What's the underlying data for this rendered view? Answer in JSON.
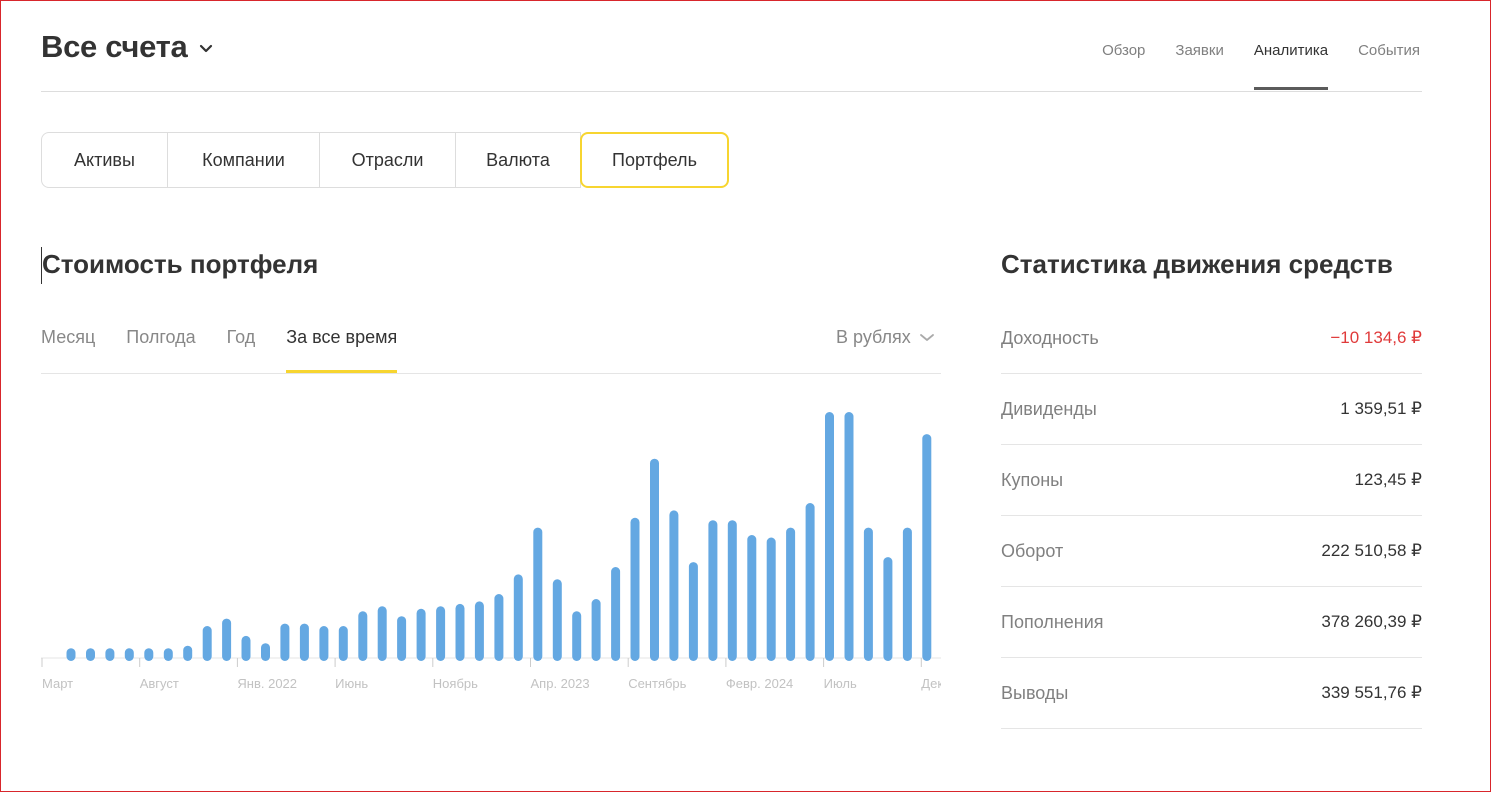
{
  "header": {
    "account_title": "Все счета",
    "tabs": [
      {
        "label": "Обзор"
      },
      {
        "label": "Заявки"
      },
      {
        "label": "Аналитика",
        "active": true
      },
      {
        "label": "События"
      }
    ]
  },
  "segments": [
    {
      "label": "Активы"
    },
    {
      "label": "Компании"
    },
    {
      "label": "Отрасли"
    },
    {
      "label": "Валюта"
    },
    {
      "label": "Портфель",
      "active": true
    }
  ],
  "portfolio": {
    "title": "Стоимость портфеля",
    "periods": [
      {
        "label": "Месяц"
      },
      {
        "label": "Полгода"
      },
      {
        "label": "Год"
      },
      {
        "label": "За все время",
        "active": true
      }
    ],
    "currency_select": "В рублях"
  },
  "chart_data": {
    "type": "bar",
    "color": "#64a8e2",
    "x_tick_labels": [
      "Март",
      "Август",
      "Янв. 2022",
      "Июнь",
      "Ноябрь",
      "Апр. 2023",
      "Сентябрь",
      "Февр. 2024",
      "Июль",
      "Дек"
    ],
    "values": [
      4,
      4,
      4,
      4,
      4,
      4,
      5,
      13,
      16,
      9,
      6,
      14,
      14,
      13,
      13,
      19,
      21,
      17,
      20,
      21,
      22,
      23,
      26,
      34,
      53,
      32,
      19,
      24,
      37,
      57,
      81,
      60,
      39,
      56,
      56,
      50,
      49,
      53,
      63,
      100,
      100,
      53,
      41,
      53,
      91
    ],
    "ylim": [
      0,
      100
    ],
    "grid": false,
    "legend": "none"
  },
  "stats": {
    "title": "Статистика движения средств",
    "rows": [
      {
        "label": "Доходность",
        "value": "−10 134,6 ₽",
        "negative": true
      },
      {
        "label": "Дивиденды",
        "value": "1 359,51 ₽"
      },
      {
        "label": "Купоны",
        "value": "123,45 ₽"
      },
      {
        "label": "Оборот",
        "value": "222 510,58 ₽"
      },
      {
        "label": "Пополнения",
        "value": "378 260,39 ₽"
      },
      {
        "label": "Выводы",
        "value": "339 551,76 ₽"
      }
    ]
  },
  "colors": {
    "accent": "#f7d530",
    "negative": "#e03a3a",
    "bar": "#64a8e2"
  }
}
